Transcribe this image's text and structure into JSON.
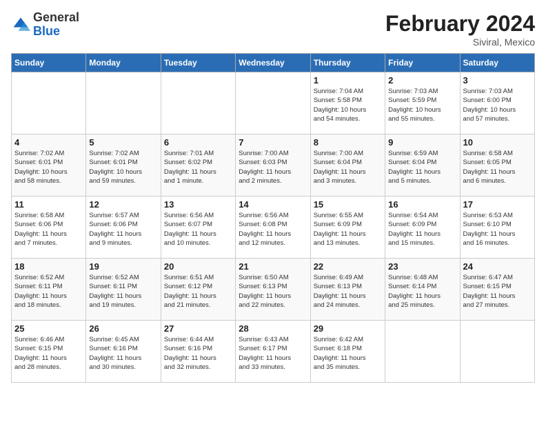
{
  "logo": {
    "general": "General",
    "blue": "Blue"
  },
  "title": "February 2024",
  "subtitle": "Siviral, Mexico",
  "days_of_week": [
    "Sunday",
    "Monday",
    "Tuesday",
    "Wednesday",
    "Thursday",
    "Friday",
    "Saturday"
  ],
  "weeks": [
    [
      {
        "day": "",
        "info": ""
      },
      {
        "day": "",
        "info": ""
      },
      {
        "day": "",
        "info": ""
      },
      {
        "day": "",
        "info": ""
      },
      {
        "day": "1",
        "info": "Sunrise: 7:04 AM\nSunset: 5:58 PM\nDaylight: 10 hours\nand 54 minutes."
      },
      {
        "day": "2",
        "info": "Sunrise: 7:03 AM\nSunset: 5:59 PM\nDaylight: 10 hours\nand 55 minutes."
      },
      {
        "day": "3",
        "info": "Sunrise: 7:03 AM\nSunset: 6:00 PM\nDaylight: 10 hours\nand 57 minutes."
      }
    ],
    [
      {
        "day": "4",
        "info": "Sunrise: 7:02 AM\nSunset: 6:01 PM\nDaylight: 10 hours\nand 58 minutes."
      },
      {
        "day": "5",
        "info": "Sunrise: 7:02 AM\nSunset: 6:01 PM\nDaylight: 10 hours\nand 59 minutes."
      },
      {
        "day": "6",
        "info": "Sunrise: 7:01 AM\nSunset: 6:02 PM\nDaylight: 11 hours\nand 1 minute."
      },
      {
        "day": "7",
        "info": "Sunrise: 7:00 AM\nSunset: 6:03 PM\nDaylight: 11 hours\nand 2 minutes."
      },
      {
        "day": "8",
        "info": "Sunrise: 7:00 AM\nSunset: 6:04 PM\nDaylight: 11 hours\nand 3 minutes."
      },
      {
        "day": "9",
        "info": "Sunrise: 6:59 AM\nSunset: 6:04 PM\nDaylight: 11 hours\nand 5 minutes."
      },
      {
        "day": "10",
        "info": "Sunrise: 6:58 AM\nSunset: 6:05 PM\nDaylight: 11 hours\nand 6 minutes."
      }
    ],
    [
      {
        "day": "11",
        "info": "Sunrise: 6:58 AM\nSunset: 6:06 PM\nDaylight: 11 hours\nand 7 minutes."
      },
      {
        "day": "12",
        "info": "Sunrise: 6:57 AM\nSunset: 6:06 PM\nDaylight: 11 hours\nand 9 minutes."
      },
      {
        "day": "13",
        "info": "Sunrise: 6:56 AM\nSunset: 6:07 PM\nDaylight: 11 hours\nand 10 minutes."
      },
      {
        "day": "14",
        "info": "Sunrise: 6:56 AM\nSunset: 6:08 PM\nDaylight: 11 hours\nand 12 minutes."
      },
      {
        "day": "15",
        "info": "Sunrise: 6:55 AM\nSunset: 6:09 PM\nDaylight: 11 hours\nand 13 minutes."
      },
      {
        "day": "16",
        "info": "Sunrise: 6:54 AM\nSunset: 6:09 PM\nDaylight: 11 hours\nand 15 minutes."
      },
      {
        "day": "17",
        "info": "Sunrise: 6:53 AM\nSunset: 6:10 PM\nDaylight: 11 hours\nand 16 minutes."
      }
    ],
    [
      {
        "day": "18",
        "info": "Sunrise: 6:52 AM\nSunset: 6:11 PM\nDaylight: 11 hours\nand 18 minutes."
      },
      {
        "day": "19",
        "info": "Sunrise: 6:52 AM\nSunset: 6:11 PM\nDaylight: 11 hours\nand 19 minutes."
      },
      {
        "day": "20",
        "info": "Sunrise: 6:51 AM\nSunset: 6:12 PM\nDaylight: 11 hours\nand 21 minutes."
      },
      {
        "day": "21",
        "info": "Sunrise: 6:50 AM\nSunset: 6:13 PM\nDaylight: 11 hours\nand 22 minutes."
      },
      {
        "day": "22",
        "info": "Sunrise: 6:49 AM\nSunset: 6:13 PM\nDaylight: 11 hours\nand 24 minutes."
      },
      {
        "day": "23",
        "info": "Sunrise: 6:48 AM\nSunset: 6:14 PM\nDaylight: 11 hours\nand 25 minutes."
      },
      {
        "day": "24",
        "info": "Sunrise: 6:47 AM\nSunset: 6:15 PM\nDaylight: 11 hours\nand 27 minutes."
      }
    ],
    [
      {
        "day": "25",
        "info": "Sunrise: 6:46 AM\nSunset: 6:15 PM\nDaylight: 11 hours\nand 28 minutes."
      },
      {
        "day": "26",
        "info": "Sunrise: 6:45 AM\nSunset: 6:16 PM\nDaylight: 11 hours\nand 30 minutes."
      },
      {
        "day": "27",
        "info": "Sunrise: 6:44 AM\nSunset: 6:16 PM\nDaylight: 11 hours\nand 32 minutes."
      },
      {
        "day": "28",
        "info": "Sunrise: 6:43 AM\nSunset: 6:17 PM\nDaylight: 11 hours\nand 33 minutes."
      },
      {
        "day": "29",
        "info": "Sunrise: 6:42 AM\nSunset: 6:18 PM\nDaylight: 11 hours\nand 35 minutes."
      },
      {
        "day": "",
        "info": ""
      },
      {
        "day": "",
        "info": ""
      }
    ]
  ]
}
